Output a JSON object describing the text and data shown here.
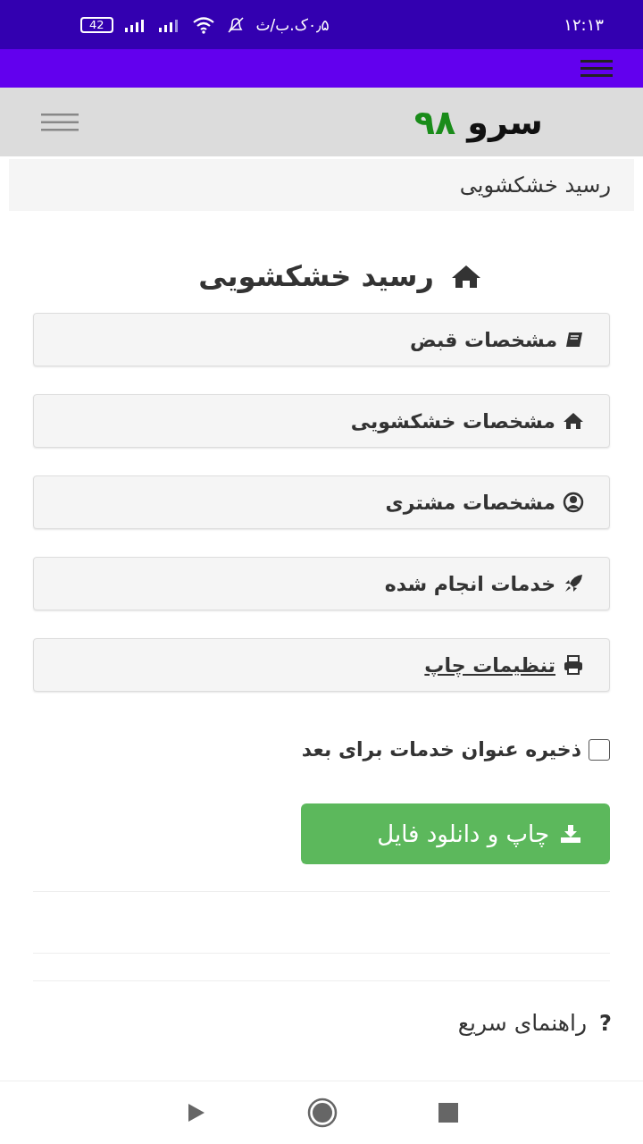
{
  "status_bar": {
    "time": "۱۲:۱۳",
    "speed": "۰٫۵ک.ب/ث",
    "battery": "42"
  },
  "header": {
    "brand_name": "سرو",
    "brand_number": "۹۸"
  },
  "breadcrumb": "رسید خشکشویی",
  "title": "رسید خشکشویی",
  "panels": [
    {
      "label": "مشخصات قبض",
      "link": false
    },
    {
      "label": "مشخصات خشکشویی",
      "link": false
    },
    {
      "label": "مشخصات مشتری",
      "link": false
    },
    {
      "label": "خدمات انجام شده",
      "link": false
    },
    {
      "label": "تنظیمات چاپ",
      "link": true
    }
  ],
  "save_option": {
    "label": "ذخیره عنوان خدمات برای بعد",
    "checked": false
  },
  "print_button": "چاپ و دانلود فایل",
  "help": {
    "icon_text": "?",
    "title": "راهنمای سریع"
  }
}
